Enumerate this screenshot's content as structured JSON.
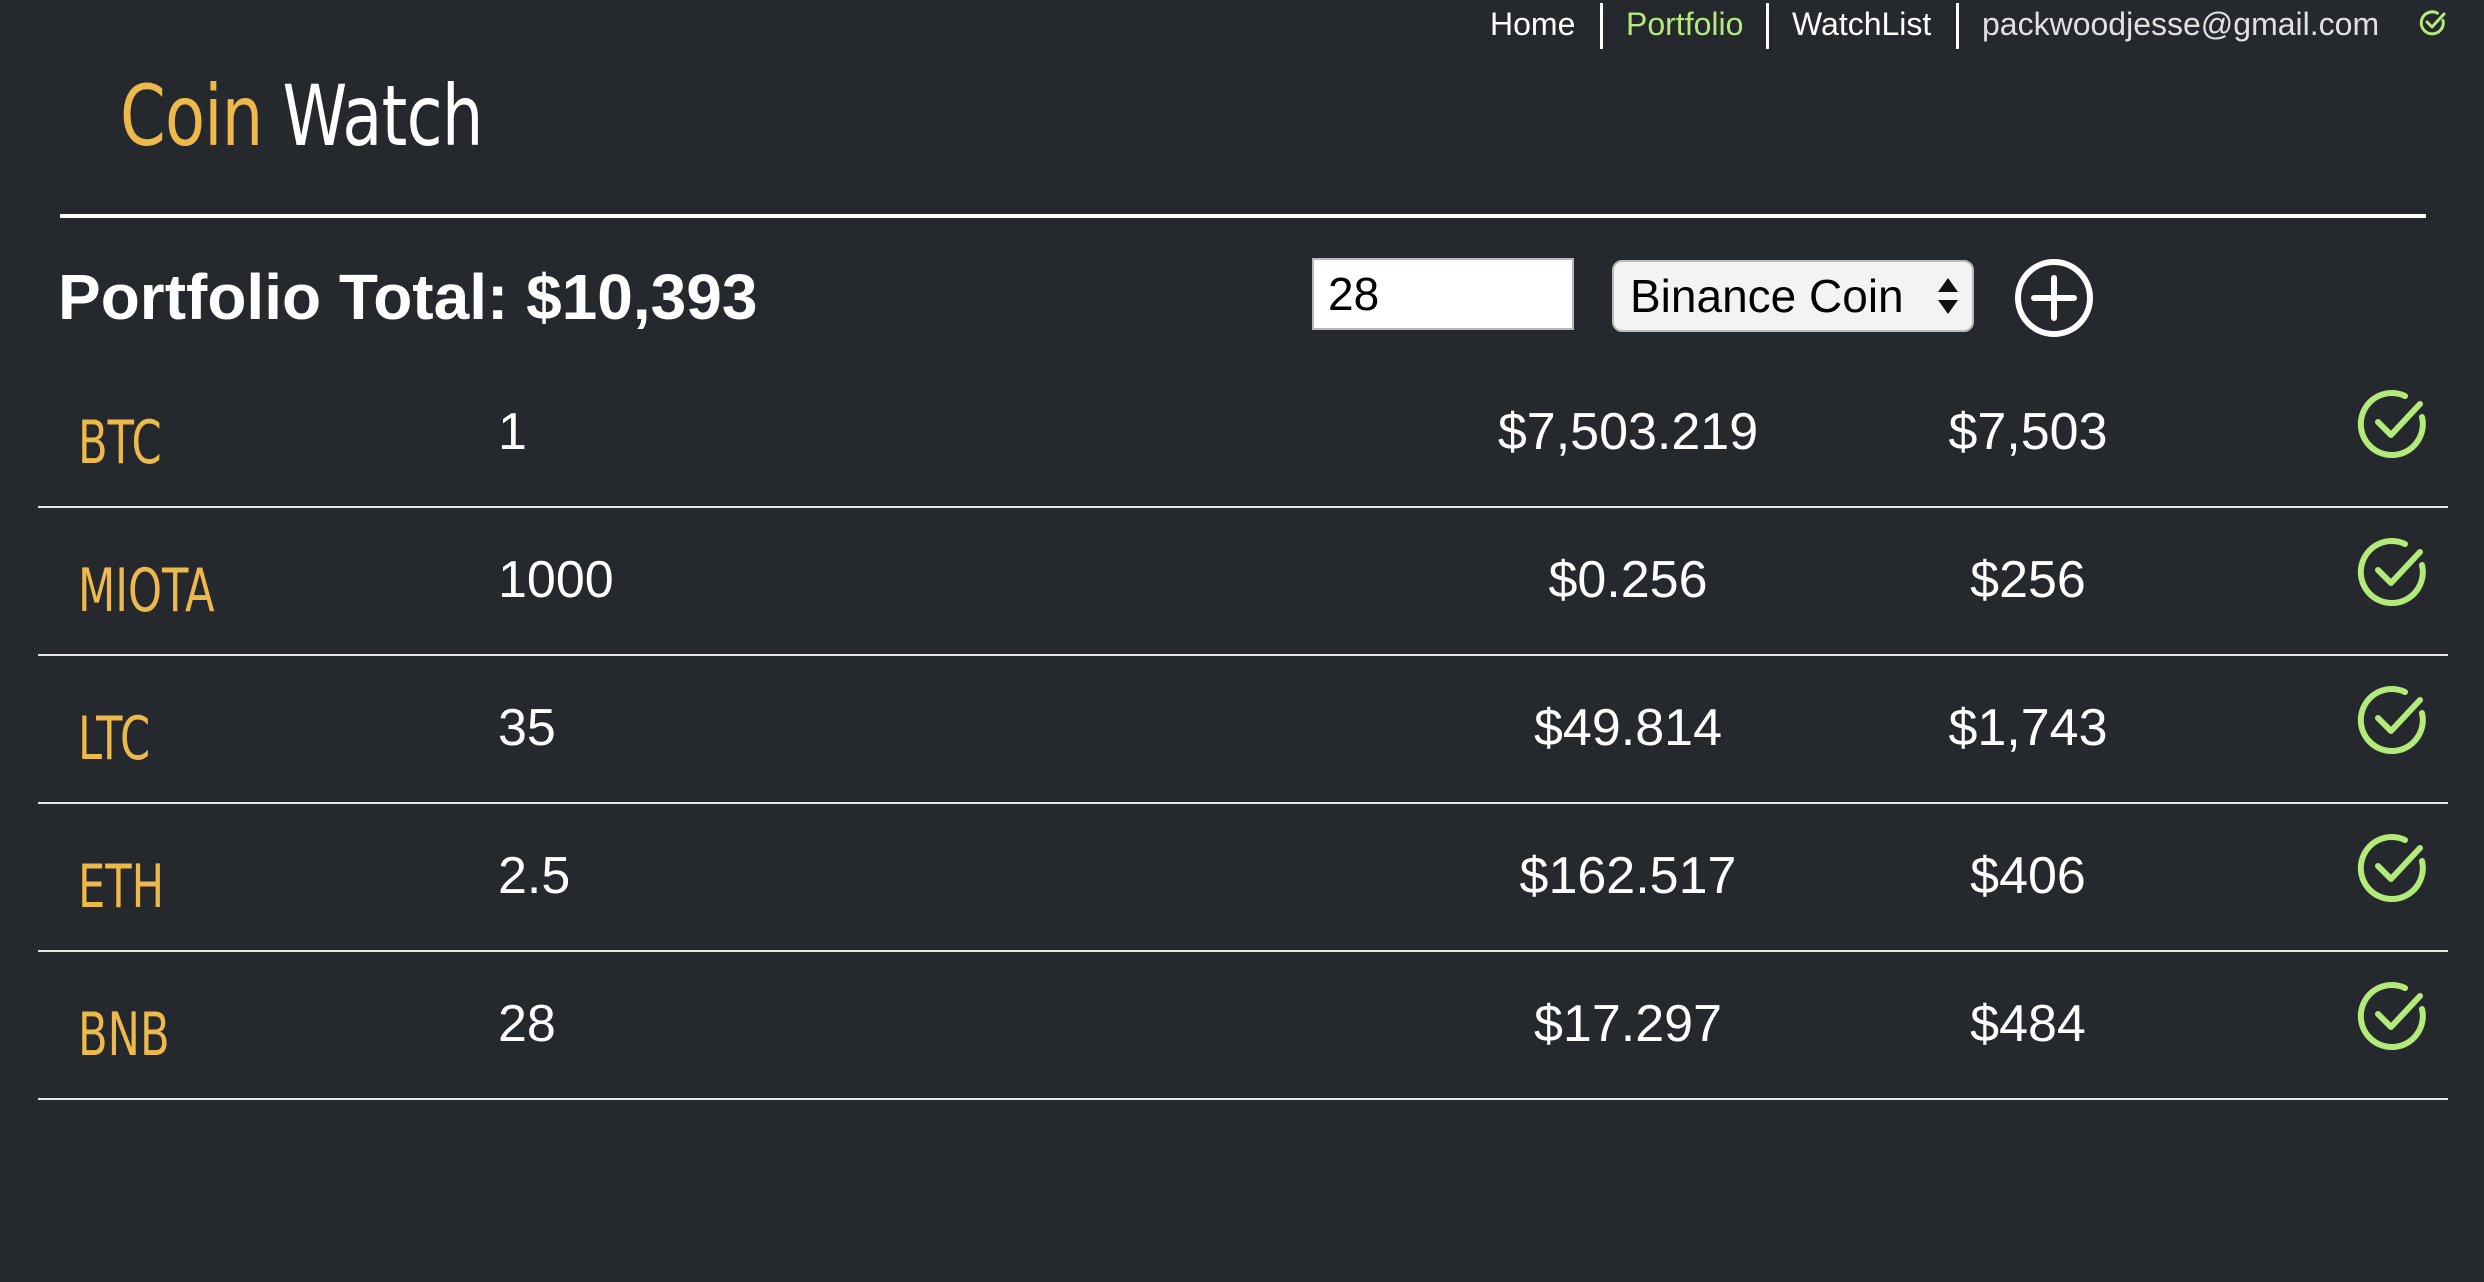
{
  "nav": {
    "items": [
      {
        "label": "Home"
      },
      {
        "label": "Portfolio",
        "active": true
      },
      {
        "label": "WatchList"
      }
    ],
    "user_email": "packwoodjesse@gmail.com",
    "status_icon": "check-circle-icon"
  },
  "brand": {
    "part1": "Coin",
    "part2": "Watch"
  },
  "portfolio": {
    "total_label": "Portfolio Total: $10,393",
    "quantity_input_value": "28",
    "coin_select_value": "Binance Coin",
    "add_icon": "plus-circle-icon"
  },
  "holdings": [
    {
      "symbol": "BTC",
      "amount": "1",
      "price": "$7,503.219",
      "value": "$7,503"
    },
    {
      "symbol": "MIOTA",
      "amount": "1000",
      "price": "$0.256",
      "value": "$256"
    },
    {
      "symbol": "LTC",
      "amount": "35",
      "price": "$49.814",
      "value": "$1,743"
    },
    {
      "symbol": "ETH",
      "amount": "2.5",
      "price": "$162.517",
      "value": "$406"
    },
    {
      "symbol": "BNB",
      "amount": "28",
      "price": "$17.297",
      "value": "$484"
    }
  ],
  "colors": {
    "background": "#25282c",
    "accent_gold": "#eeb94b",
    "accent_green": "#b4ea7a",
    "text": "#ffffff"
  }
}
